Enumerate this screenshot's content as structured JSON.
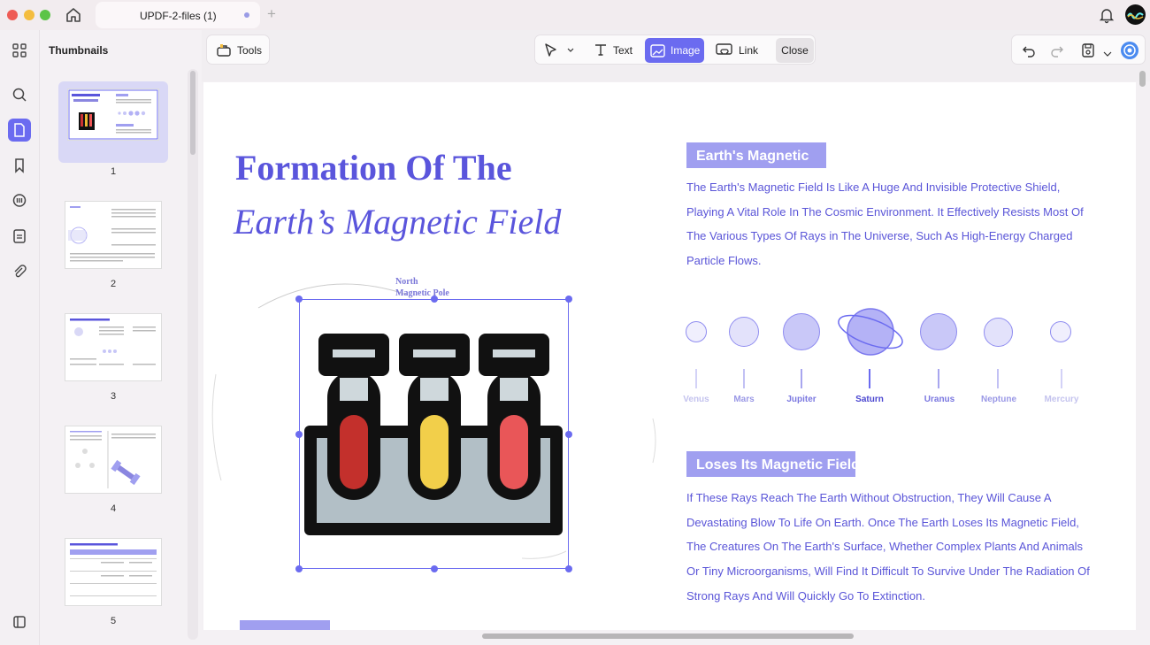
{
  "window": {
    "tab_title": "UPDF-2-files (1)",
    "new_tab_symbol": "+"
  },
  "sidebar": {
    "title": "Thumbnails",
    "pages": [
      "1",
      "2",
      "3",
      "4",
      "5"
    ]
  },
  "toolbar": {
    "tools_label": "Tools",
    "text_label": "Text",
    "image_label": "Image",
    "link_label": "Link",
    "close_label": "Close"
  },
  "document": {
    "title_line1": "Formation Of The",
    "title_line2": "Earth’s Magnetic Field",
    "pole_label_line1": "North",
    "pole_label_line2": "Magnetic Pole",
    "section1_heading": "Earth's Magnetic",
    "section1_text": "The Earth's Magnetic Field Is Like A Huge And Invisible Protective Shield, Playing A Vital Role In The Cosmic Environment. It Effectively Resists Most Of The Various Types Of Rays in The Universe, Such As High-Energy Charged Particle Flows.",
    "section2_heading": "Loses Its Magnetic Field",
    "section2_text": "If These Rays Reach The Earth Without Obstruction, They Will Cause A Devastating Blow To Life On Earth. Once The Earth Loses Its Magnetic Field, The Creatures On The Earth's Surface, Whether Complex Plants And Animals Or Tiny Microorganisms, Will Find It Difficult To Survive Under The Radiation Of Strong Rays And Will Quickly Go To Extinction.",
    "planets": [
      "Venus",
      "Mars",
      "Jupiter",
      "Saturn",
      "Uranus",
      "Neptune",
      "Mercury"
    ]
  },
  "colors": {
    "accent": "#6b6bf0",
    "heading": "#5a55dc",
    "badge": "#a09ff0"
  }
}
